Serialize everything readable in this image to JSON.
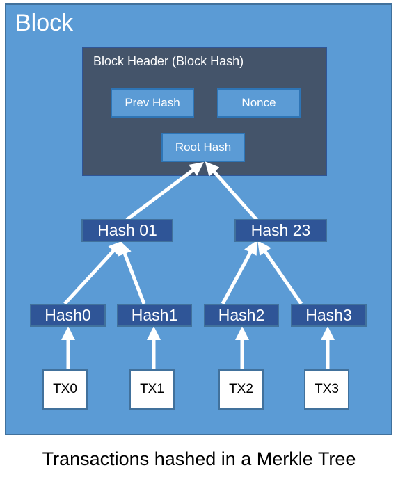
{
  "diagram": {
    "block": {
      "title": "Block"
    },
    "header": {
      "title": "Block Header (Block Hash)",
      "fields": {
        "prev_hash": "Prev Hash",
        "nonce": "Nonce",
        "root_hash": "Root Hash"
      }
    },
    "level1": [
      "Hash 01",
      "Hash 23"
    ],
    "level2": [
      "Hash0",
      "Hash1",
      "Hash2",
      "Hash3"
    ],
    "transactions": [
      "TX0",
      "TX1",
      "TX2",
      "TX3"
    ],
    "edges": [
      {
        "from": "Hash 01",
        "to": "Root Hash"
      },
      {
        "from": "Hash 23",
        "to": "Root Hash"
      },
      {
        "from": "Hash0",
        "to": "Hash 01"
      },
      {
        "from": "Hash1",
        "to": "Hash 01"
      },
      {
        "from": "Hash2",
        "to": "Hash 23"
      },
      {
        "from": "Hash3",
        "to": "Hash 23"
      },
      {
        "from": "TX0",
        "to": "Hash0"
      },
      {
        "from": "TX1",
        "to": "Hash1"
      },
      {
        "from": "TX2",
        "to": "Hash2"
      },
      {
        "from": "TX3",
        "to": "Hash3"
      }
    ],
    "colors": {
      "block": "#5b9bd5",
      "header": "#44546a",
      "hash_node": "#2f5597",
      "arrow": "#ffffff"
    }
  },
  "caption": "Transactions hashed in a Merkle Tree"
}
